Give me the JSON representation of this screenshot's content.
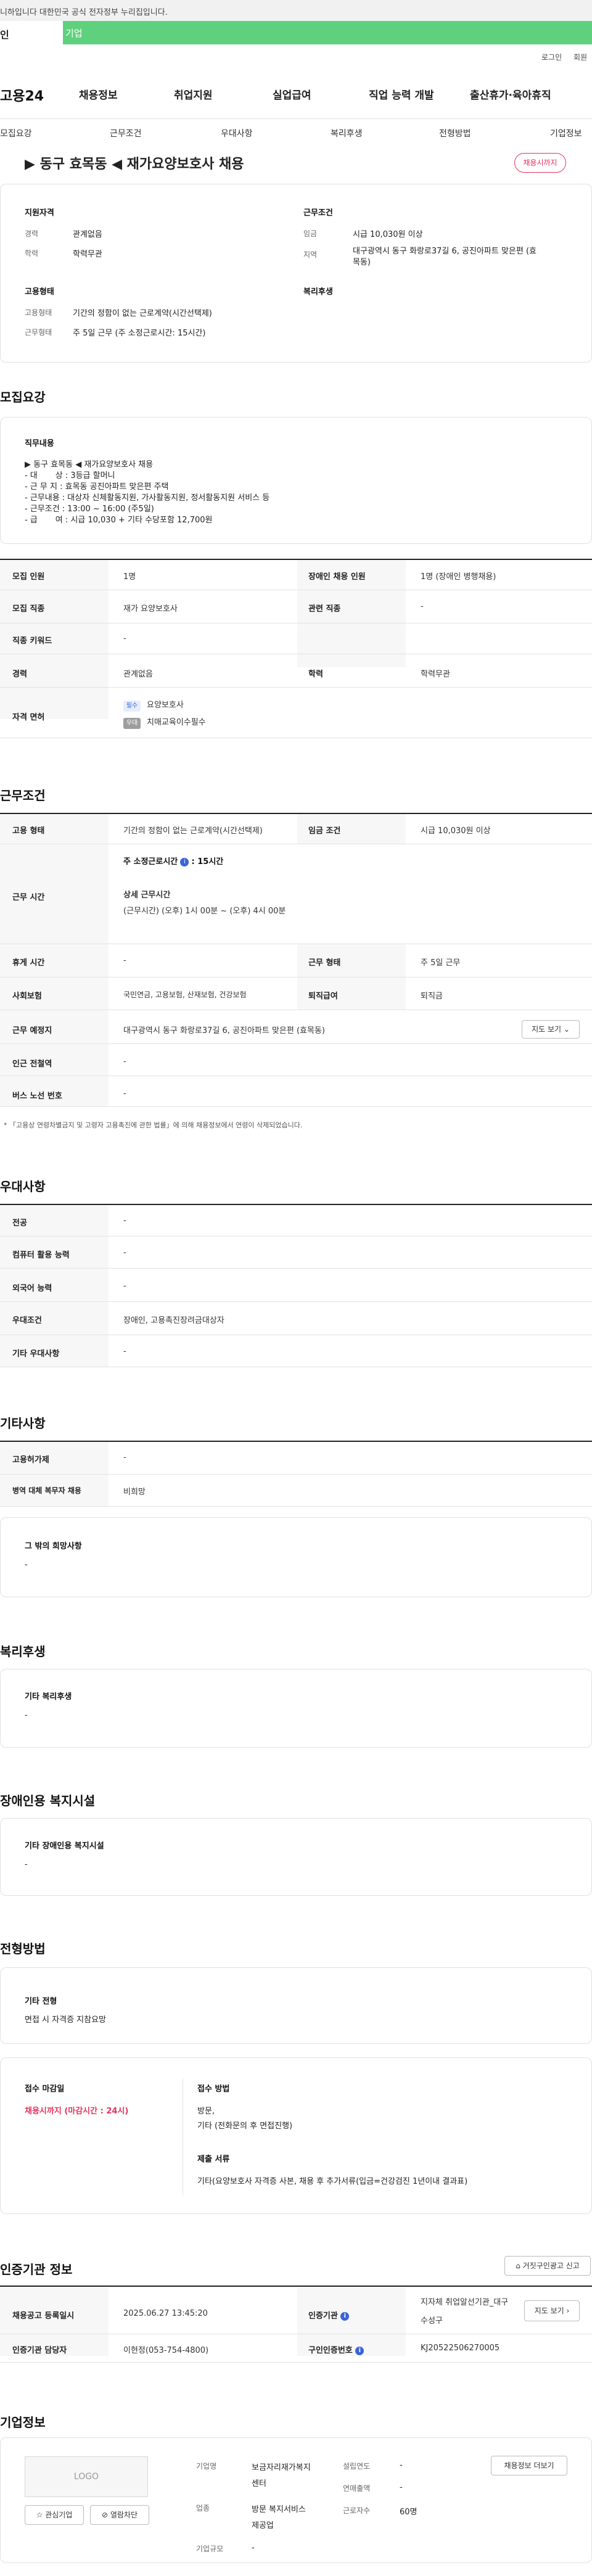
{
  "gov_notice": "니하입니다 대한민국 공식 전자정부 누리집입니다.",
  "tabs": {
    "individual": "인",
    "business": "기업"
  },
  "util": {
    "login": "로그인",
    "join": "회원"
  },
  "logo": "고용24",
  "gnb": [
    "채용정보",
    "취업지원",
    "실업급여",
    "직업 능력 개발",
    "출산휴가·육아휴직"
  ],
  "subnav": [
    "모집요강",
    "근무조건",
    "우대사항",
    "복리후생",
    "전형방법",
    "기업정보"
  ],
  "header": {
    "title": "▶ 동구 효목동 ◀ 재가요양보호사 채용",
    "badge": "채용시까지",
    "qual_title": "지원자격",
    "career_label": "경력",
    "career_value": "관계없음",
    "edu_label": "학력",
    "edu_value": "학력무관",
    "cond_title": "근무조건",
    "wage_label": "임금",
    "wage_value": "시급 10,030원 이상",
    "region_label": "지역",
    "region_value_1": "대구광역시 동구 화랑로37길 6, 공진아파트 맞은편 (효",
    "region_value_2": "목동)",
    "emp_title": "고용형태",
    "emp_type_label": "고용형태",
    "emp_type_value": "기간의 정함이 없는 근로계약(시간선택제)",
    "work_form_label": "근무형태",
    "work_form_value": "주 5일 근무 (주 소정근로시간: 15시간)",
    "welfare_title": "복리후생"
  },
  "recruit": {
    "section_title": "모집요강",
    "duty_title": "직무내용",
    "duty_lines": [
      "▶ 동구 효목동 ◀ 재가요양보호사 채용",
      "- 대       상 : 3등급 할머니",
      "- 근 무 지 : 효목동 공진아파트 맞은편 주택",
      "- 근무내용 : 대상자 신체활동지원, 가사활동지원, 정서활동지원 서비스 등",
      "- 근무조건 : 13:00 ~ 16:00 (주5일)",
      "- 급       여 : 시급 10,030 + 기타 수당포함 12,700원"
    ],
    "rows": {
      "headcount_label": "모집 인원",
      "headcount": "1명",
      "disabled_label": "장애인 채용 인원",
      "disabled": "1명 (장애인 병행채용)",
      "job_label": "모집 직종",
      "job": "재가 요양보호사",
      "related_label": "관련 직종",
      "related": "-",
      "keyword_label": "직종 키워드",
      "keyword": "-",
      "career_label": "경력",
      "career": "관계없음",
      "edu_label": "학력",
      "edu": "학력무관",
      "license_label": "자격 면허",
      "license_1_tag": "필수",
      "license_1": "요양보호사",
      "license_2_tag": "우대",
      "license_2": "치매교육이수필수"
    }
  },
  "work": {
    "section_title": "근무조건",
    "emp_type_label": "고용 형태",
    "emp_type": "기간의 정함이 없는 근로계약(시간선택제)",
    "wage_label": "임금 조건",
    "wage": "시급 10,030원 이상",
    "hours_label": "근무 시간",
    "weekly_label": "주 소정근로시간",
    "weekly_info": "i",
    "weekly_value": ": 15시간",
    "detail_label": "상세 근무시간",
    "detail_value": "(근무시간) (오후) 1시 00분 ~ (오후) 4시 00분",
    "break_label": "휴게 시간",
    "break": "-",
    "form_label": "근무 형태",
    "form": "주 5일 근무",
    "insurance_label": "사회보험",
    "insurance": "국민연금, 고용보험, 산재보험, 건강보험",
    "severance_label": "퇴직급여",
    "severance": "퇴직금",
    "place_label": "근무 예정지",
    "place": "대구광역시 동구 화랑로37길 6, 공진아파트 맞은편 (효목동)",
    "map_btn": "지도 보기 ⌄",
    "subway_label": "인근 전철역",
    "subway": "-",
    "bus_label": "버스 노선 번호",
    "bus": "-",
    "note": "* 「고용상 연령차별금지 및 고령자 고용촉진에 관한 법률」에 의해 채용정보에서 연령이 삭제되었습니다."
  },
  "pref": {
    "section_title": "우대사항",
    "major_label": "전공",
    "major": "-",
    "pc_label": "컴퓨터 활용 능력",
    "pc": "-",
    "lang_label": "외국어 능력",
    "lang": "-",
    "cond_label": "우대조건",
    "cond": "장애인, 고용촉진장려금대상자",
    "etc_label": "기타 우대사항",
    "etc": "-"
  },
  "other": {
    "section_title": "기타사항",
    "equip_label": "고용허가제",
    "equip": "-",
    "military_label": "병역 대체 복무자 채용",
    "military": "비희망",
    "other_hope_title": "그 밖의 희망사항",
    "other_hope": "-"
  },
  "welfare": {
    "section_title": "복리후생",
    "box_title": "기타 복리후생",
    "box_value": "-"
  },
  "disability": {
    "section_title": "장애인용 복지시설",
    "box_title": "기타 장애인용 복지시설",
    "box_value": "-"
  },
  "selection": {
    "section_title": "전형방법",
    "box_title": "기타 전형",
    "box_value": "면접 시 자격증 지참요망",
    "deadline_title": "접수 마감일",
    "deadline_value": "채용시까지 (마감시간 : 24시)",
    "method_title": "접수 방법",
    "method_1": "방문,",
    "method_2": "기타 (전화문의 후 면접진행)",
    "docs_title": "제출 서류",
    "docs_value": "기타(요양보호사 자격증 사본, 채용 후 추가서류(입금=건강검진 1년이내 결과표)"
  },
  "agency": {
    "section_title": "인증기관 정보",
    "report_btn": "거짓구인광고 신고",
    "reg_label": "채용공고 등록일시",
    "reg": "2025.06.27 13:45:20",
    "agency_label": "인증기관",
    "agency_1": "지자체 취업알선기관_대구",
    "agency_2": "수성구",
    "map_btn": "지도 보기",
    "manager_label": "인증기관 담당자",
    "manager": "이현정(053-754-4800)",
    "reqno_label": "구인인증번호",
    "reqno": "KJ20522506270005"
  },
  "company": {
    "section_title": "기업정보",
    "logo_text": "LOGO",
    "fav_btn": "☆ 관심기업",
    "block_btn": "⊘ 열람차단",
    "name_label": "기업명",
    "name_1": "보금자리재가복지",
    "name_2": "센터",
    "industry_label": "업종",
    "industry_1": "방문 복지서비스",
    "industry_2": "제공업",
    "size_label": "기업규모",
    "size": "-",
    "founded_label": "설립연도",
    "founded": "-",
    "sales_label": "연매출액",
    "sales": "-",
    "staff_label": "근로자수",
    "staff": "60명",
    "jobs_btn": "채용정보 더보기"
  }
}
